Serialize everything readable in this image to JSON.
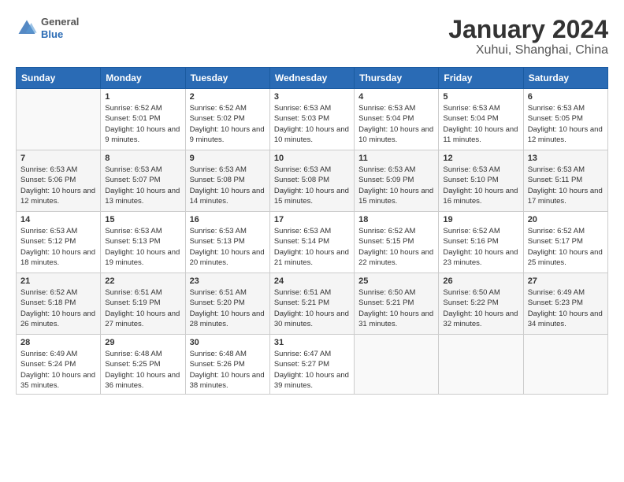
{
  "header": {
    "logo_general": "General",
    "logo_blue": "Blue",
    "month_title": "January 2024",
    "location": "Xuhui, Shanghai, China"
  },
  "weekdays": [
    "Sunday",
    "Monday",
    "Tuesday",
    "Wednesday",
    "Thursday",
    "Friday",
    "Saturday"
  ],
  "weeks": [
    [
      {
        "day": "",
        "sunrise": "",
        "sunset": "",
        "daylight": ""
      },
      {
        "day": "1",
        "sunrise": "Sunrise: 6:52 AM",
        "sunset": "Sunset: 5:01 PM",
        "daylight": "Daylight: 10 hours and 9 minutes."
      },
      {
        "day": "2",
        "sunrise": "Sunrise: 6:52 AM",
        "sunset": "Sunset: 5:02 PM",
        "daylight": "Daylight: 10 hours and 9 minutes."
      },
      {
        "day": "3",
        "sunrise": "Sunrise: 6:53 AM",
        "sunset": "Sunset: 5:03 PM",
        "daylight": "Daylight: 10 hours and 10 minutes."
      },
      {
        "day": "4",
        "sunrise": "Sunrise: 6:53 AM",
        "sunset": "Sunset: 5:04 PM",
        "daylight": "Daylight: 10 hours and 10 minutes."
      },
      {
        "day": "5",
        "sunrise": "Sunrise: 6:53 AM",
        "sunset": "Sunset: 5:04 PM",
        "daylight": "Daylight: 10 hours and 11 minutes."
      },
      {
        "day": "6",
        "sunrise": "Sunrise: 6:53 AM",
        "sunset": "Sunset: 5:05 PM",
        "daylight": "Daylight: 10 hours and 12 minutes."
      }
    ],
    [
      {
        "day": "7",
        "sunrise": "Sunrise: 6:53 AM",
        "sunset": "Sunset: 5:06 PM",
        "daylight": "Daylight: 10 hours and 12 minutes."
      },
      {
        "day": "8",
        "sunrise": "Sunrise: 6:53 AM",
        "sunset": "Sunset: 5:07 PM",
        "daylight": "Daylight: 10 hours and 13 minutes."
      },
      {
        "day": "9",
        "sunrise": "Sunrise: 6:53 AM",
        "sunset": "Sunset: 5:08 PM",
        "daylight": "Daylight: 10 hours and 14 minutes."
      },
      {
        "day": "10",
        "sunrise": "Sunrise: 6:53 AM",
        "sunset": "Sunset: 5:08 PM",
        "daylight": "Daylight: 10 hours and 15 minutes."
      },
      {
        "day": "11",
        "sunrise": "Sunrise: 6:53 AM",
        "sunset": "Sunset: 5:09 PM",
        "daylight": "Daylight: 10 hours and 15 minutes."
      },
      {
        "day": "12",
        "sunrise": "Sunrise: 6:53 AM",
        "sunset": "Sunset: 5:10 PM",
        "daylight": "Daylight: 10 hours and 16 minutes."
      },
      {
        "day": "13",
        "sunrise": "Sunrise: 6:53 AM",
        "sunset": "Sunset: 5:11 PM",
        "daylight": "Daylight: 10 hours and 17 minutes."
      }
    ],
    [
      {
        "day": "14",
        "sunrise": "Sunrise: 6:53 AM",
        "sunset": "Sunset: 5:12 PM",
        "daylight": "Daylight: 10 hours and 18 minutes."
      },
      {
        "day": "15",
        "sunrise": "Sunrise: 6:53 AM",
        "sunset": "Sunset: 5:13 PM",
        "daylight": "Daylight: 10 hours and 19 minutes."
      },
      {
        "day": "16",
        "sunrise": "Sunrise: 6:53 AM",
        "sunset": "Sunset: 5:13 PM",
        "daylight": "Daylight: 10 hours and 20 minutes."
      },
      {
        "day": "17",
        "sunrise": "Sunrise: 6:53 AM",
        "sunset": "Sunset: 5:14 PM",
        "daylight": "Daylight: 10 hours and 21 minutes."
      },
      {
        "day": "18",
        "sunrise": "Sunrise: 6:52 AM",
        "sunset": "Sunset: 5:15 PM",
        "daylight": "Daylight: 10 hours and 22 minutes."
      },
      {
        "day": "19",
        "sunrise": "Sunrise: 6:52 AM",
        "sunset": "Sunset: 5:16 PM",
        "daylight": "Daylight: 10 hours and 23 minutes."
      },
      {
        "day": "20",
        "sunrise": "Sunrise: 6:52 AM",
        "sunset": "Sunset: 5:17 PM",
        "daylight": "Daylight: 10 hours and 25 minutes."
      }
    ],
    [
      {
        "day": "21",
        "sunrise": "Sunrise: 6:52 AM",
        "sunset": "Sunset: 5:18 PM",
        "daylight": "Daylight: 10 hours and 26 minutes."
      },
      {
        "day": "22",
        "sunrise": "Sunrise: 6:51 AM",
        "sunset": "Sunset: 5:19 PM",
        "daylight": "Daylight: 10 hours and 27 minutes."
      },
      {
        "day": "23",
        "sunrise": "Sunrise: 6:51 AM",
        "sunset": "Sunset: 5:20 PM",
        "daylight": "Daylight: 10 hours and 28 minutes."
      },
      {
        "day": "24",
        "sunrise": "Sunrise: 6:51 AM",
        "sunset": "Sunset: 5:21 PM",
        "daylight": "Daylight: 10 hours and 30 minutes."
      },
      {
        "day": "25",
        "sunrise": "Sunrise: 6:50 AM",
        "sunset": "Sunset: 5:21 PM",
        "daylight": "Daylight: 10 hours and 31 minutes."
      },
      {
        "day": "26",
        "sunrise": "Sunrise: 6:50 AM",
        "sunset": "Sunset: 5:22 PM",
        "daylight": "Daylight: 10 hours and 32 minutes."
      },
      {
        "day": "27",
        "sunrise": "Sunrise: 6:49 AM",
        "sunset": "Sunset: 5:23 PM",
        "daylight": "Daylight: 10 hours and 34 minutes."
      }
    ],
    [
      {
        "day": "28",
        "sunrise": "Sunrise: 6:49 AM",
        "sunset": "Sunset: 5:24 PM",
        "daylight": "Daylight: 10 hours and 35 minutes."
      },
      {
        "day": "29",
        "sunrise": "Sunrise: 6:48 AM",
        "sunset": "Sunset: 5:25 PM",
        "daylight": "Daylight: 10 hours and 36 minutes."
      },
      {
        "day": "30",
        "sunrise": "Sunrise: 6:48 AM",
        "sunset": "Sunset: 5:26 PM",
        "daylight": "Daylight: 10 hours and 38 minutes."
      },
      {
        "day": "31",
        "sunrise": "Sunrise: 6:47 AM",
        "sunset": "Sunset: 5:27 PM",
        "daylight": "Daylight: 10 hours and 39 minutes."
      },
      {
        "day": "",
        "sunrise": "",
        "sunset": "",
        "daylight": ""
      },
      {
        "day": "",
        "sunrise": "",
        "sunset": "",
        "daylight": ""
      },
      {
        "day": "",
        "sunrise": "",
        "sunset": "",
        "daylight": ""
      }
    ]
  ]
}
